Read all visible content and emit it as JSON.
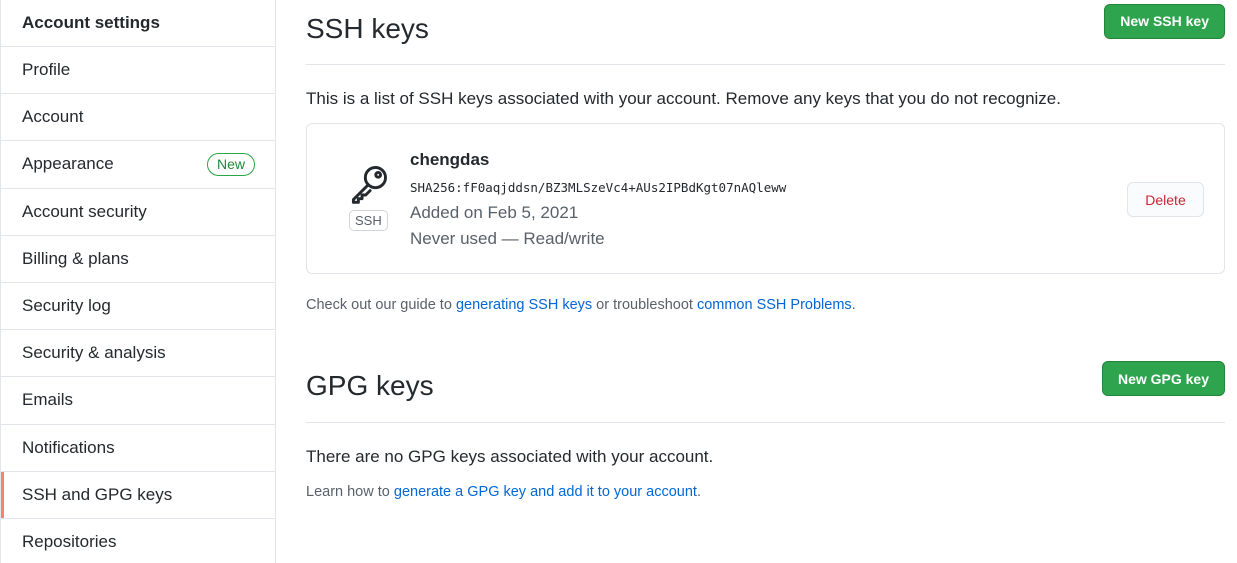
{
  "sidebar": {
    "header": "Account settings",
    "items": [
      {
        "label": "Profile"
      },
      {
        "label": "Account"
      },
      {
        "label": "Appearance",
        "badge": "New"
      },
      {
        "label": "Account security"
      },
      {
        "label": "Billing & plans"
      },
      {
        "label": "Security log"
      },
      {
        "label": "Security & analysis"
      },
      {
        "label": "Emails"
      },
      {
        "label": "Notifications"
      },
      {
        "label": "SSH and GPG keys",
        "selected": true
      },
      {
        "label": "Repositories"
      }
    ]
  },
  "ssh": {
    "title": "SSH keys",
    "new_button": "New SSH key",
    "description": "This is a list of SSH keys associated with your account. Remove any keys that you do not recognize.",
    "key": {
      "icon": "key-icon",
      "type_label": "SSH",
      "title": "chengdas",
      "fingerprint": "SHA256:fF0aqjddsn/BZ3MLSzeVc4+AUs2IPBdKgt07nAQleww",
      "added": "Added on Feb 5, 2021",
      "usage": "Never used — Read/write",
      "delete_label": "Delete"
    },
    "guide": {
      "prefix": "Check out our guide to ",
      "link1": "generating SSH keys",
      "middle": " or troubleshoot ",
      "link2": "common SSH Problems",
      "suffix": "."
    }
  },
  "gpg": {
    "title": "GPG keys",
    "new_button": "New GPG key",
    "empty": "There are no GPG keys associated with your account.",
    "learn": {
      "prefix": "Learn how to ",
      "link": "generate a GPG key and add it to your account",
      "suffix": "."
    }
  },
  "colors": {
    "accent_green": "#2ea44f",
    "selected_indicator": "#f9826c",
    "link": "#0366d6",
    "danger": "#cb2431"
  }
}
